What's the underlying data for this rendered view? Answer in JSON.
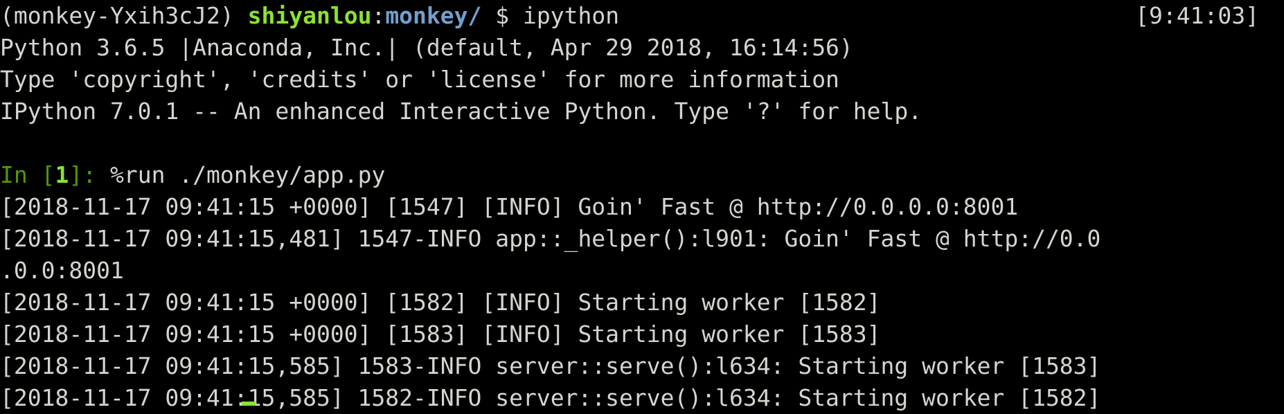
{
  "colors": {
    "background": "#000000",
    "foreground": "#d3d7cf",
    "prompt_user": "#8ae234",
    "prompt_path": "#729fcf",
    "ipython_in": "#4e9a06",
    "cursor": "#8ae234"
  },
  "prompt": {
    "env": "(monkey-Yxih3cJ2) ",
    "user": "shiyanlou",
    "colon": ":",
    "path": "monkey/",
    "rest": " $ ipython",
    "time": "[9:41:03]"
  },
  "banner": [
    "Python 3.6.5 |Anaconda, Inc.| (default, Apr 29 2018, 16:14:56)",
    "Type 'copyright', 'credits' or 'license' for more information",
    "IPython 7.0.1 -- An enhanced Interactive Python. Type '?' for help."
  ],
  "input": {
    "label_open": "In [",
    "number": "1",
    "label_close": "]: ",
    "command": "%run ./monkey/app.py"
  },
  "log_lines": [
    "[2018-11-17 09:41:15 +0000] [1547] [INFO] Goin' Fast @ http://0.0.0.0:8001",
    "[2018-11-17 09:41:15,481] 1547-INFO app::_helper():l901: Goin' Fast @ http://0.0",
    ".0.0:8001",
    "[2018-11-17 09:41:15 +0000] [1582] [INFO] Starting worker [1582]",
    "[2018-11-17 09:41:15 +0000] [1583] [INFO] Starting worker [1583]",
    "[2018-11-17 09:41:15,585] 1583-INFO server::serve():l634: Starting worker [1583]",
    "[2018-11-17 09:41:15,585] 1582-INFO server::serve():l634: Starting worker [1582]"
  ]
}
